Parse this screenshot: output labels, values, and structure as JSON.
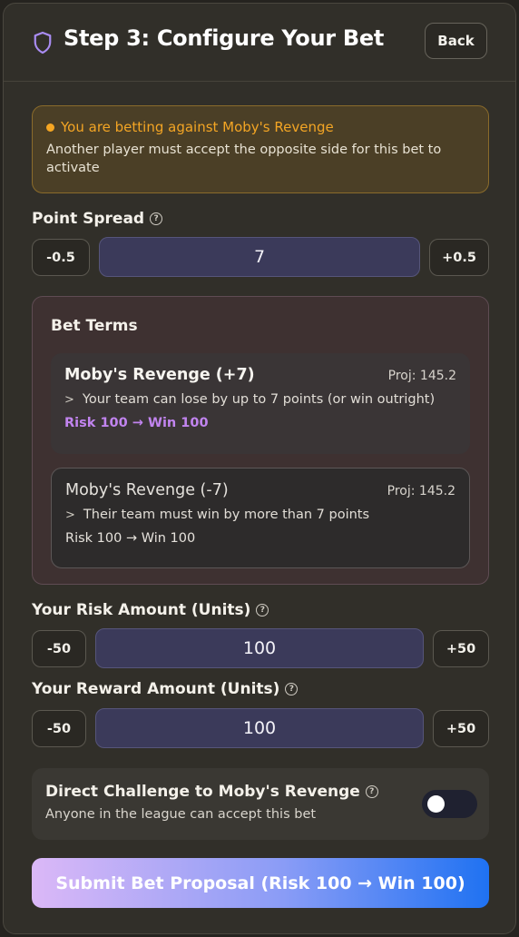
{
  "header": {
    "title": "Step 3: Configure Your Bet",
    "back_label": "Back"
  },
  "alert": {
    "title": "You are betting against Moby's Revenge",
    "text": "Another player must accept the opposite side for this bet to activate"
  },
  "point_spread": {
    "label": "Point Spread",
    "help": "?",
    "decrement": "-0.5",
    "value": "7",
    "increment": "+0.5"
  },
  "bet_terms": {
    "title": "Bet Terms",
    "options": [
      {
        "name": "Moby's Revenge (+7)",
        "proj": "Proj: 145.2",
        "desc": "Your team can lose by up to 7 points (or win outright)",
        "risk": "Risk 100 → Win 100",
        "selected": true
      },
      {
        "name": "Moby's Revenge (-7)",
        "proj": "Proj: 145.2",
        "desc": "Their team must win by more than 7 points",
        "risk": "Risk 100 → Win 100",
        "selected": false
      }
    ]
  },
  "risk": {
    "label": "Your Risk Amount (Units)",
    "help": "?",
    "decrement": "-50",
    "value": "100",
    "increment": "+50"
  },
  "reward": {
    "label": "Your Reward Amount (Units)",
    "help": "?",
    "decrement": "-50",
    "value": "100",
    "increment": "+50"
  },
  "challenge": {
    "title": "Direct Challenge to Moby's Revenge",
    "help": "?",
    "subtitle": "Anyone in the league can accept this bet",
    "enabled": false
  },
  "submit_label": "Submit Bet Proposal (Risk 100 → Win 100)",
  "colors": {
    "accent_purple": "#c184ef",
    "warning": "#f3a524",
    "submit_gradient_end": "#1f72f2"
  }
}
